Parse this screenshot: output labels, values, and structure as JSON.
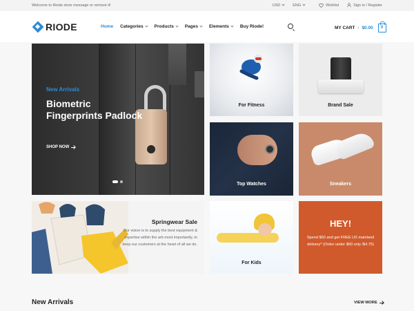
{
  "topbar": {
    "message": "Welcome to Riode store message or remove it!",
    "currency": "USD",
    "language": "ENG",
    "wishlist": "Wishlist",
    "account": "Sign in / Register"
  },
  "header": {
    "logo": "RIODE",
    "nav": [
      "Home",
      "Categories",
      "Products",
      "Pages",
      "Elements",
      "Buy Riode!"
    ],
    "cart_label": "MY CART",
    "cart_sep": "/",
    "cart_amount": "$0.00",
    "cart_count": "0"
  },
  "hero": {
    "eyebrow": "New Arrivals",
    "title": "Biometric Fingerprints Padlock",
    "cta": "SHOP NOW"
  },
  "tiles": {
    "fitness": "For Fitness",
    "brand_sale": "Brand Sale",
    "watches": "Top Watches",
    "sneakers": "Sneakers",
    "kids": "For Kids"
  },
  "springwear": {
    "title": "Springwear Sale",
    "description": "Our vision is to supply the best equipment & expertise within the arb most importantly, to keep our customers at the heart of all we do."
  },
  "promo": {
    "title": "HEY!",
    "text": "Spend $60 and get FREE US mainland delivery* (Order under $60 only /$4.75)"
  },
  "arrivals": {
    "title": "New Arrivals",
    "view_more": "VIEW MORE"
  },
  "colors": {
    "accent": "#2b8bd6",
    "promo": "#d05a2c"
  }
}
